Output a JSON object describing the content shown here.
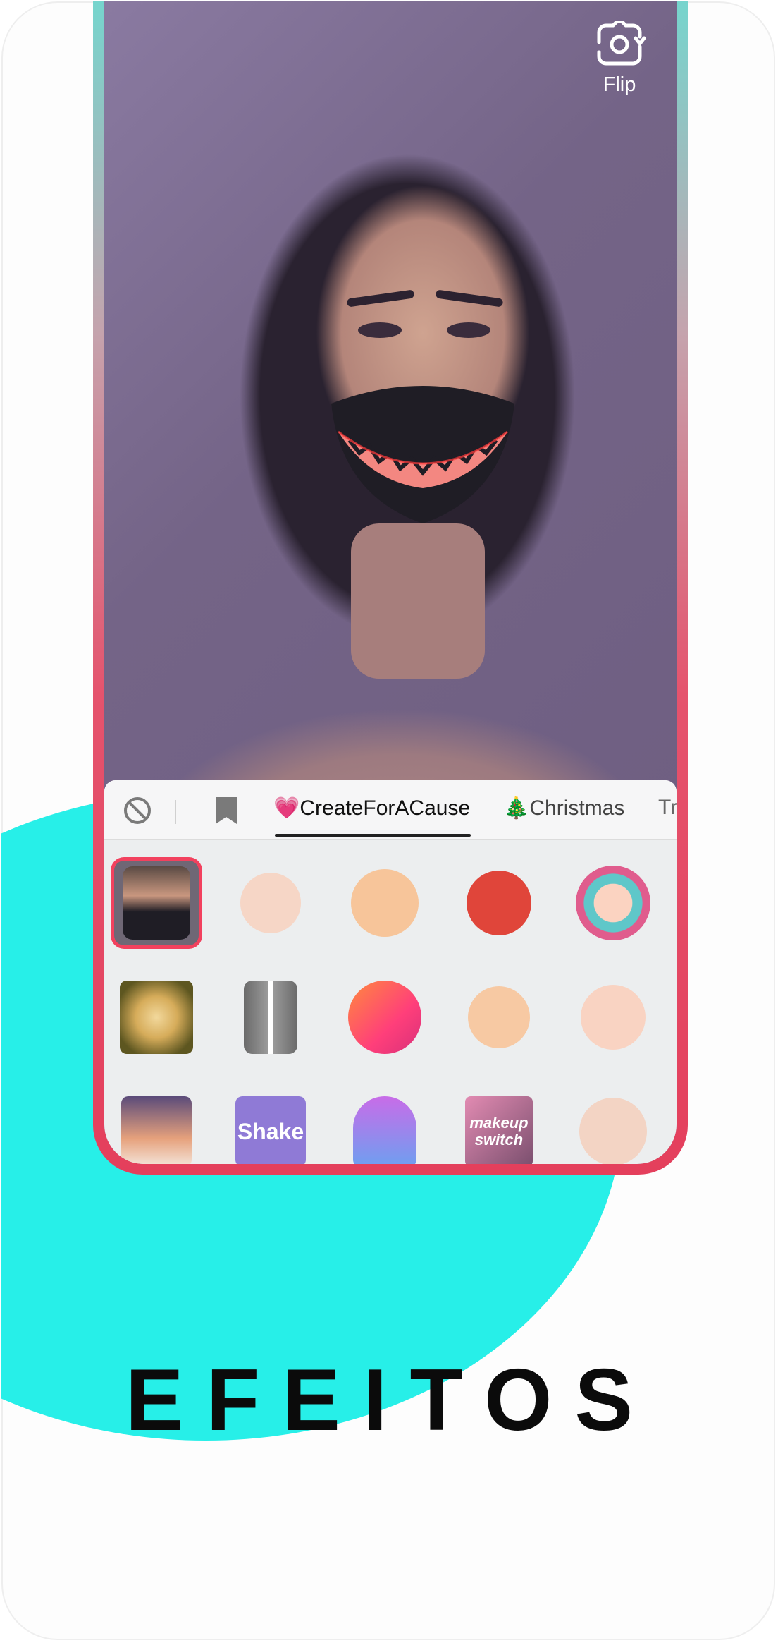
{
  "camera": {
    "flip_label": "Flip"
  },
  "effects_panel": {
    "tabs": [
      {
        "label": "💗CreateForACause",
        "active": true
      },
      {
        "label": "🎄Christmas",
        "active": false
      },
      {
        "label": "Tr",
        "active": false
      }
    ],
    "icons": [
      "no-effect-icon",
      "bookmark-icon"
    ],
    "rows": [
      [
        "glowing-smile-mask",
        "spiders-face",
        "heart-glasses-face",
        "red-monster-face",
        "hooded-face"
      ],
      [
        "golden-blur-face",
        "suit-outfit",
        "sparkle-effect",
        "sad-face",
        "cute-big-eyes-face"
      ],
      [
        "airplane-wing",
        "shake",
        "purple-hair-avatar",
        "makeup-switch",
        "stars-crown-face"
      ]
    ],
    "tile_labels": {
      "shake": "Shake",
      "makeup_switch": "makeup switch"
    },
    "selected_index": 0
  },
  "headline": {
    "text": "EFEITOS"
  },
  "colors": {
    "accent_cyan": "#27efe8",
    "accent_red": "#e43f5c",
    "selection": "#f2415e"
  }
}
